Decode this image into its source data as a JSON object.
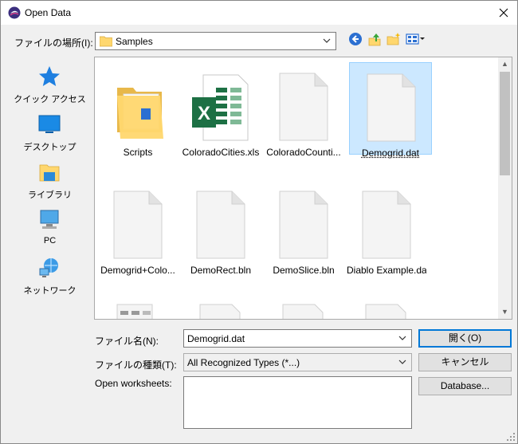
{
  "window": {
    "title": "Open Data",
    "close_icon": "close-icon"
  },
  "lookin": {
    "label": "ファイルの場所(I):",
    "value": "Samples"
  },
  "places": [
    {
      "label": "クイック アクセス",
      "icon": "star-icon"
    },
    {
      "label": "デスクトップ",
      "icon": "desktop-icon"
    },
    {
      "label": "ライブラリ",
      "icon": "library-icon"
    },
    {
      "label": "PC",
      "icon": "pc-icon"
    },
    {
      "label": "ネットワーク",
      "icon": "network-icon"
    }
  ],
  "files": [
    {
      "name": "Scripts",
      "type": "folder"
    },
    {
      "name": "ColoradoCities.xls",
      "type": "excel"
    },
    {
      "name": "ColoradoCounti...",
      "type": "doc"
    },
    {
      "name": "Demogrid.dat",
      "type": "doc",
      "selected": true
    },
    {
      "name": "Demogrid+Colo...",
      "type": "doc"
    },
    {
      "name": "DemoRect.bln",
      "type": "doc"
    },
    {
      "name": "DemoSlice.bln",
      "type": "doc"
    },
    {
      "name": "Diablo Example.dat",
      "type": "doc"
    }
  ],
  "filename": {
    "label": "ファイル名(N):",
    "value": "Demogrid.dat"
  },
  "filetype": {
    "label": "ファイルの種類(T):",
    "value": "All Recognized Types (*...)"
  },
  "worksheets": {
    "label": "Open worksheets:"
  },
  "buttons": {
    "open": "開く(O)",
    "cancel": "キャンセル",
    "database": "Database..."
  },
  "colors": {
    "accent": "#0078d7",
    "selection": "#cce8ff",
    "folder": "#ffd76e",
    "excel": "#1d7044"
  }
}
